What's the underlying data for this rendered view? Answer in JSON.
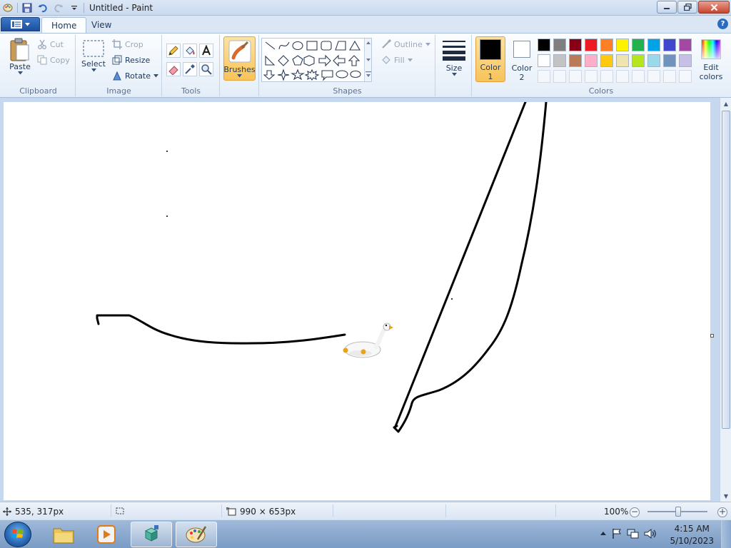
{
  "window": {
    "title": "Untitled - Paint",
    "buttons": {
      "minimize": "minimize",
      "restore": "restore",
      "close": "close"
    }
  },
  "tabs": [
    {
      "label": "Home",
      "active": true
    },
    {
      "label": "View",
      "active": false
    }
  ],
  "help": "?",
  "ribbon": {
    "clipboard": {
      "label": "Clipboard",
      "paste": "Paste",
      "cut": "Cut",
      "copy": "Copy"
    },
    "image": {
      "label": "Image",
      "select": "Select",
      "crop": "Crop",
      "resize": "Resize",
      "rotate": "Rotate"
    },
    "tools": {
      "label": "Tools"
    },
    "brushes": {
      "label": "Brushes"
    },
    "shapes": {
      "label": "Shapes",
      "outline": "Outline",
      "fill": "Fill"
    },
    "size": {
      "label": "Size"
    },
    "colors": {
      "label": "Colors",
      "color1_label_1": "Color",
      "color1_label_2": "1",
      "color2_label_1": "Color",
      "color2_label_2": "2",
      "color1_value": "#000000",
      "color2_value": "#ffffff",
      "edit_label_1": "Edit",
      "edit_label_2": "colors",
      "palette_row1": [
        "#000000",
        "#7f7f7f",
        "#880015",
        "#ed1c24",
        "#ff7f27",
        "#fff200",
        "#22b14c",
        "#00a2e8",
        "#3f48cc",
        "#a349a4"
      ],
      "palette_row2": [
        "#ffffff",
        "#c3c3c3",
        "#b97a57",
        "#ffaec9",
        "#ffc90e",
        "#efe4b0",
        "#b5e61d",
        "#99d9ea",
        "#7092be",
        "#c8bfe7"
      ]
    }
  },
  "status": {
    "cursor_position": "535, 317px",
    "image_size": "990 × 653px",
    "zoom": "100%",
    "zoom_minus": "−",
    "zoom_plus": "+"
  },
  "taskbar": {
    "time": "4:15 AM",
    "date": "5/10/2023",
    "items": [
      "explorer",
      "media-player",
      "app-cube",
      "paint"
    ]
  }
}
